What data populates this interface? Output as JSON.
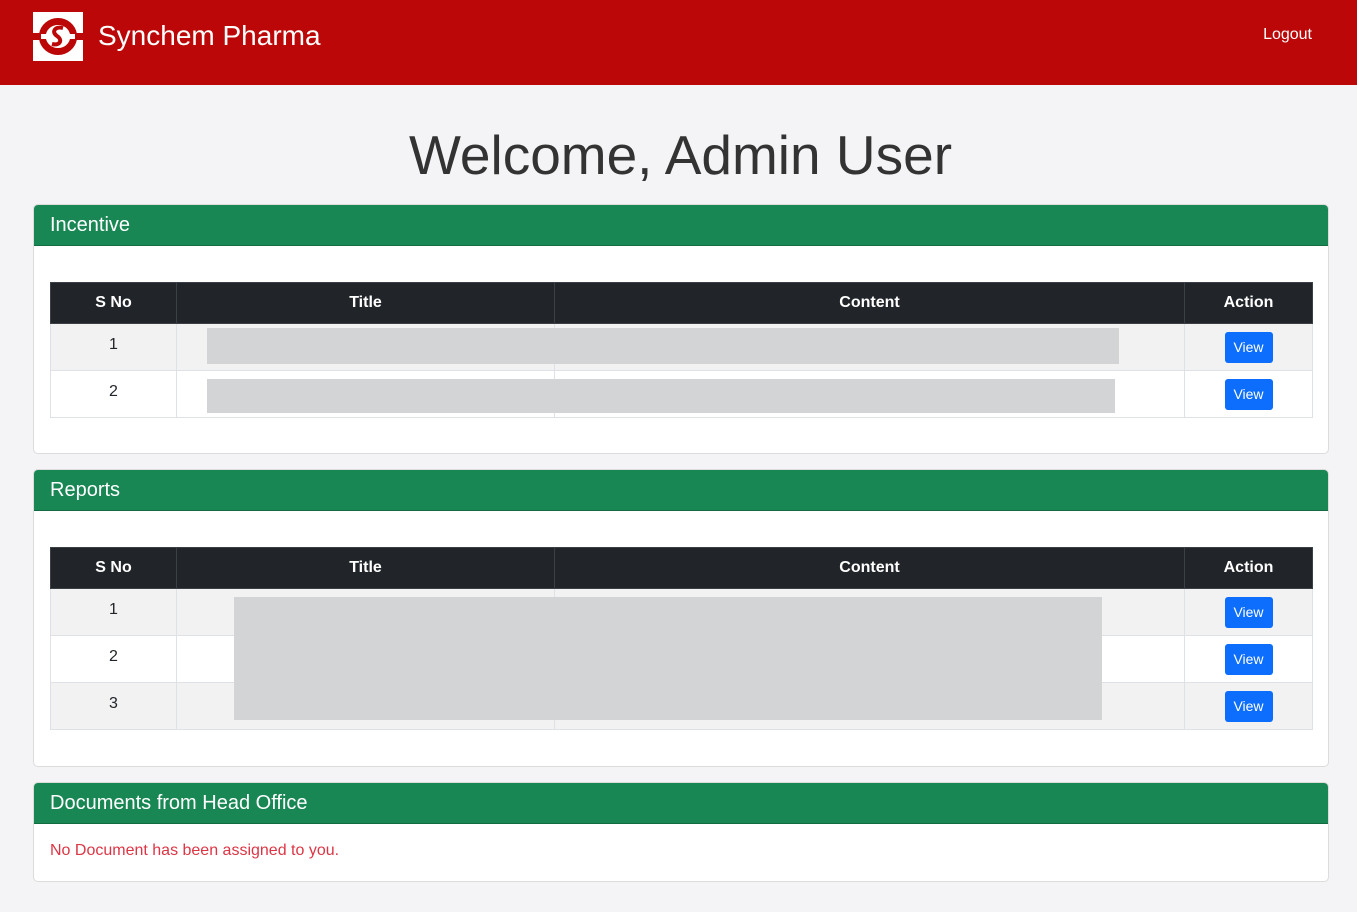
{
  "app": {
    "brand": "Synchem Pharma",
    "logout_label": "Logout",
    "logo_icon": "synchem-logo-icon",
    "brand_color": "#bb0707",
    "accent_color": "#198754"
  },
  "main": {
    "welcome": "Welcome, Admin User"
  },
  "incentive": {
    "title": "Incentive",
    "columns": [
      "S No",
      "Title",
      "Content",
      "Action"
    ],
    "rows": [
      {
        "sno": "1",
        "action": "View"
      },
      {
        "sno": "2",
        "action": "View"
      }
    ]
  },
  "reports": {
    "title": "Reports",
    "columns": [
      "S No",
      "Title",
      "Content",
      "Action"
    ],
    "rows": [
      {
        "sno": "1",
        "action": "View"
      },
      {
        "sno": "2",
        "action": "View"
      },
      {
        "sno": "3",
        "action": "View"
      }
    ]
  },
  "documents": {
    "title": "Documents from Head Office",
    "empty_message": "No Document has been assigned to you."
  }
}
